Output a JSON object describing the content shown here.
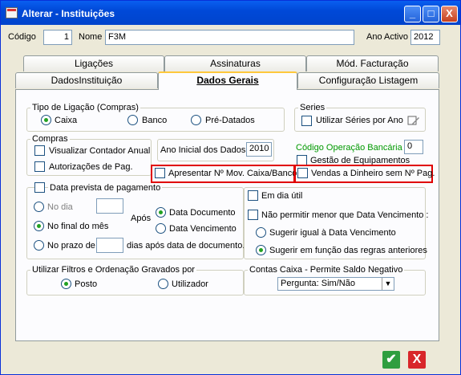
{
  "window": {
    "title": "Alterar - Instituições",
    "min": "_",
    "max": "□",
    "close": "X"
  },
  "header": {
    "codigo_label": "Código",
    "codigo_value": "1",
    "nome_label": "Nome",
    "nome_value": "F3M",
    "ano_label": "Ano Activo",
    "ano_value": "2012"
  },
  "tabs": {
    "ligacoes": "Ligações",
    "assinaturas": "Assinaturas",
    "mod_facturacao": "Mód. Facturação",
    "dados_instituicao": "DadosInstituição",
    "dados_gerais": "Dados Gerais",
    "config_listagem": "Configuração Listagem"
  },
  "tipo_ligacao": {
    "title": "Tipo de Ligação (Compras)",
    "caixa": "Caixa",
    "banco": "Banco",
    "pre_datados": "Pré-Datados"
  },
  "series": {
    "title": "Series",
    "utilizar": "Utilizar Séries por Ano"
  },
  "compras": {
    "title": "Compras",
    "visualizar": "Visualizar Contador Anual",
    "autorizacoes": "Autorizações de Pag."
  },
  "ano_inicial": {
    "label": "Ano Inicial dos Dados",
    "value": "2010"
  },
  "cod_op_bancaria": {
    "label": "Código Operação Bancária",
    "value": "0"
  },
  "gestao_equip": "Gestão de Equipamentos",
  "apresentar": "Apresentar Nº Mov. Caixa/Banco",
  "vendas": "Vendas a Dinheiro sem Nº Pag.",
  "data_prevista": {
    "title": "Data prevista de pagamento",
    "no_dia": "No dia",
    "no_final": "No final do mês",
    "no_prazo": "No prazo de",
    "apos": "Após",
    "data_documento": "Data Documento",
    "data_vencimento": "Data Vencimento",
    "dias_apos": "dias após data de documento."
  },
  "dia_util": {
    "em_dia_util": "Em dia útil",
    "nao_permitir": "Não permitir menor que Data Vencimento :",
    "sugerir_igual": "Sugerir igual à Data Vencimento",
    "sugerir_funcao": "Sugerir em função das regras anteriores"
  },
  "filtros": {
    "title": "Utilizar Filtros e Ordenação Gravados por",
    "posto": "Posto",
    "utilizador": "Utilizador"
  },
  "contas_caixa": {
    "title": "Contas Caixa - Permite Saldo Negativo",
    "value": "Pergunta: Sim/Não"
  },
  "footer": {
    "ok": "✔",
    "cancel": "X"
  }
}
